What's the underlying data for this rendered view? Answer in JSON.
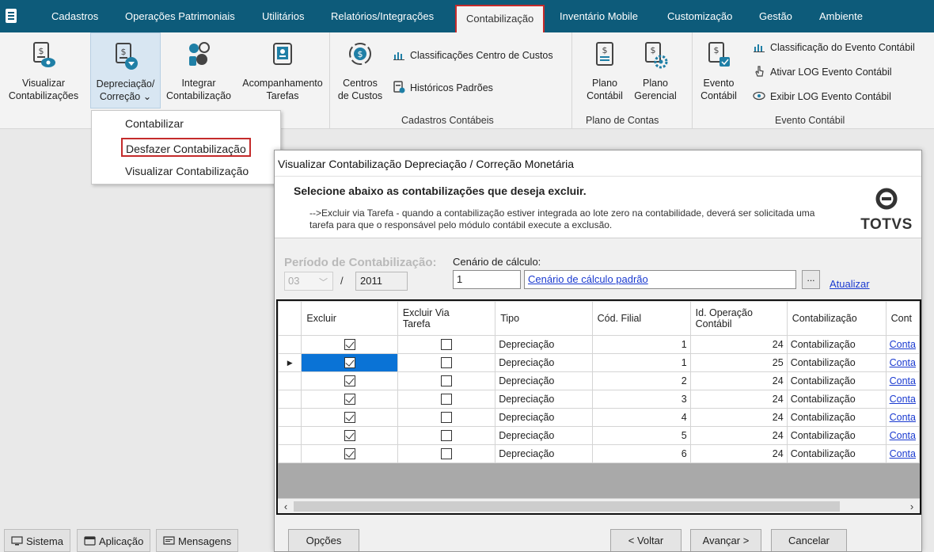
{
  "menubar": {
    "items": [
      "Cadastros",
      "Operações Patrimoniais",
      "Utilitários",
      "Relatórios/Integrações",
      "Contabilização",
      "Inventário Mobile",
      "Customização",
      "Gestão",
      "Ambiente"
    ]
  },
  "ribbon": {
    "buttons": [
      {
        "label": "Visualizar\nContabilizações",
        "icon": "document-eye-icon"
      },
      {
        "label": "Depreciação/\nCorreção ⌄",
        "icon": "document-money-icon"
      },
      {
        "label": "Integrar\nContabilização",
        "icon": "integration-icon"
      },
      {
        "label": "Acompanhamento\nTarefas",
        "icon": "task-tracking-icon"
      },
      {
        "label": "Centros\nde Custos",
        "icon": "cost-center-icon"
      },
      {
        "label": "Plano\nContábil",
        "icon": "document-money-icon"
      },
      {
        "label": "Plano\nGerencial",
        "icon": "document-gear-icon"
      },
      {
        "label": "Evento\nContábil",
        "icon": "document-event-icon"
      }
    ],
    "small": [
      "Classificações Centro de Custos",
      "Históricos Padrões",
      "Classificação do Evento Contábil",
      "Ativar LOG Evento Contábil",
      "Exibir LOG Evento Contábil"
    ],
    "groups": [
      "Cadastros Contábeis",
      "Plano de Contas",
      "Evento Contábil"
    ]
  },
  "dropdown": {
    "items": [
      "Contabilizar",
      "Desfazer Contabilização",
      "Visualizar Contabilização"
    ]
  },
  "bottom_tabs": [
    "Sistema",
    "Aplicação",
    "Mensagens"
  ],
  "dialog": {
    "title": "Visualizar Contabilização Depreciação / Correção Monetária",
    "header_title": "Selecione abaixo as contabilizações que deseja excluir.",
    "header_desc": "-->Excluir via Tarefa - quando a contabilização estiver integrada ao lote zero na contabilidade, deverá ser solicitada uma tarefa para que o responsável pelo módulo contábil execute a exclusão.",
    "logo_text": "TOTVS",
    "period_label": "Período de Contabilização:",
    "month": "03",
    "slash": "/",
    "year": "2011",
    "scenario_label": "Cenário de cálculo:",
    "scenario_code": "1",
    "scenario_name": "Cenário de cálculo padrão",
    "browse_label": "...",
    "refresh_label": "Atualizar",
    "columns": [
      "Excluir",
      "Excluir Via\nTarefa",
      "Tipo",
      "Cód. Filial",
      "Id. Operação\nContábil",
      "Contabilização",
      "Cont"
    ],
    "rows": [
      {
        "excluir": true,
        "via_tarefa": false,
        "tipo": "Depreciação",
        "filial": "1",
        "id_op": "24",
        "contab": "Contabilização",
        "link": "Conta"
      },
      {
        "excluir": true,
        "via_tarefa": false,
        "tipo": "Depreciação",
        "filial": "1",
        "id_op": "25",
        "contab": "Contabilização",
        "link": "Conta"
      },
      {
        "excluir": true,
        "via_tarefa": false,
        "tipo": "Depreciação",
        "filial": "2",
        "id_op": "24",
        "contab": "Contabilização",
        "link": "Conta"
      },
      {
        "excluir": true,
        "via_tarefa": false,
        "tipo": "Depreciação",
        "filial": "3",
        "id_op": "24",
        "contab": "Contabilização",
        "link": "Conta"
      },
      {
        "excluir": true,
        "via_tarefa": false,
        "tipo": "Depreciação",
        "filial": "4",
        "id_op": "24",
        "contab": "Contabilização",
        "link": "Conta"
      },
      {
        "excluir": true,
        "via_tarefa": false,
        "tipo": "Depreciação",
        "filial": "5",
        "id_op": "24",
        "contab": "Contabilização",
        "link": "Conta"
      },
      {
        "excluir": true,
        "via_tarefa": false,
        "tipo": "Depreciação",
        "filial": "6",
        "id_op": "24",
        "contab": "Contabilização",
        "link": "Conta"
      }
    ],
    "current_row_marker": "▶",
    "buttons": {
      "options": "Opções",
      "back": "< Voltar",
      "next": "Avançar >",
      "cancel": "Cancelar"
    }
  },
  "colors": {
    "menubar": "#0d5b7a",
    "highlight_border": "#c42b2b",
    "link": "#1a3ad0",
    "selection": "#0a73d6"
  }
}
